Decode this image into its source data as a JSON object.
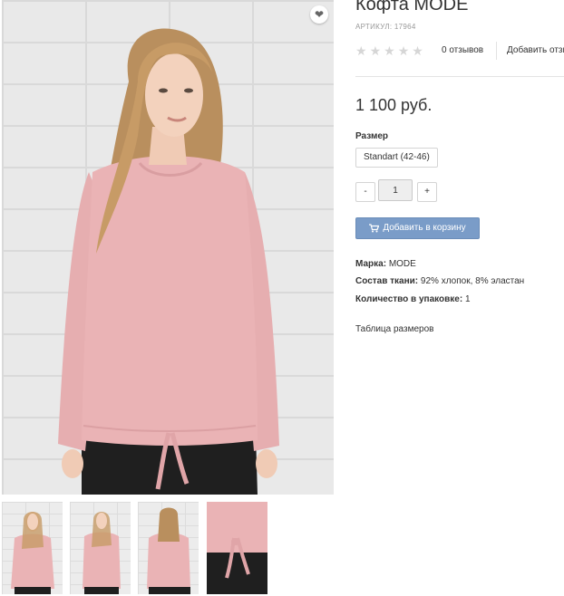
{
  "product": {
    "title": "Кофта MODE",
    "article": "АРТИКУЛ: 17964",
    "price": "1 100 руб."
  },
  "rating": {
    "stars_filled": 0,
    "stars_total": 5,
    "reviews": "0 отзывов",
    "add_review": "Добавить отзыв"
  },
  "size": {
    "label": "Размер",
    "selected": "Standart (42-46)"
  },
  "quantity": {
    "minus": "-",
    "value": "1",
    "plus": "+"
  },
  "cart": {
    "button": "Добавить в корзину"
  },
  "attributes": [
    {
      "name": "Марка:",
      "value": "MODE"
    },
    {
      "name": "Состав ткани:",
      "value": "92% хлопок, 8% эластан"
    },
    {
      "name": "Количество в упаковке:",
      "value": "1"
    }
  ],
  "size_table": "Таблица размеров",
  "icons": {
    "wishlist": "heart-icon",
    "star": "star-icon",
    "cart": "cart-icon"
  },
  "colors": {
    "sweater": "#eab3b5",
    "button": "#7a9cc8",
    "star_empty": "#d6d6d6"
  }
}
